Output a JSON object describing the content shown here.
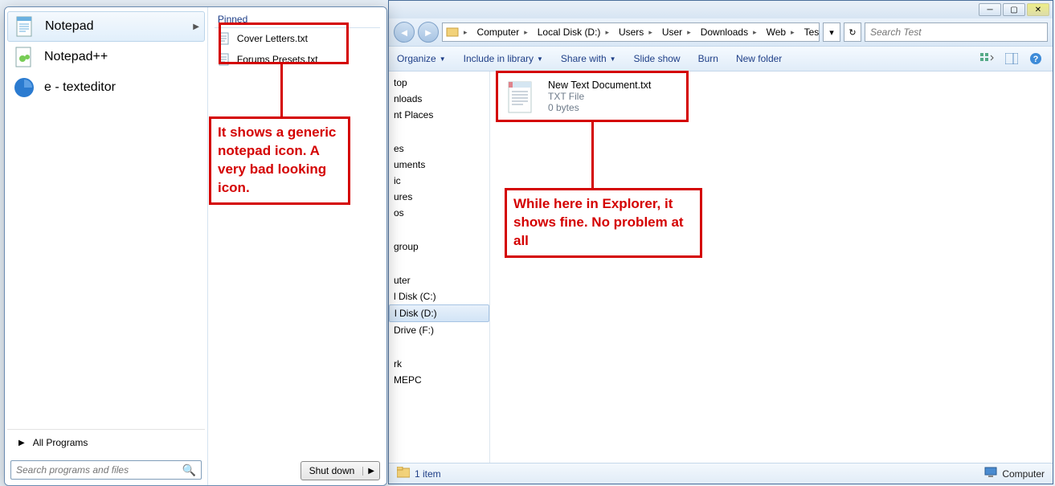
{
  "start_menu": {
    "programs": [
      {
        "name": "Notepad",
        "arrow": true,
        "highlight": true
      },
      {
        "name": "Notepad++",
        "arrow": false,
        "highlight": false
      },
      {
        "name": "e - texteditor",
        "arrow": false,
        "highlight": false
      }
    ],
    "pinned_header": "Pinned",
    "pinned_items": [
      "Cover Letters.txt",
      "Forums Presets.txt"
    ],
    "all_programs": "All Programs",
    "search_placeholder": "Search programs and files",
    "shutdown": "Shut down"
  },
  "explorer": {
    "breadcrumb": [
      "Computer",
      "Local Disk (D:)",
      "Users",
      "User",
      "Downloads",
      "Web",
      "Test"
    ],
    "search_placeholder": "Search Test",
    "toolbar": {
      "organize": "Organize",
      "include": "Include in library",
      "share": "Share with",
      "slideshow": "Slide show",
      "burn": "Burn",
      "newfolder": "New folder"
    },
    "navpane": {
      "group1": [
        "top",
        "nloads",
        "nt Places"
      ],
      "group2": [
        "es",
        "uments",
        "ic",
        "ures",
        "os"
      ],
      "group3": [
        "group"
      ],
      "group4": [
        "uter",
        "l Disk (C:)",
        "l Disk (D:)",
        "Drive (F:)"
      ],
      "group5": [
        "rk",
        "MEPC"
      ]
    },
    "file": {
      "name": "New Text Document.txt",
      "type": "TXT File",
      "size": "0 bytes"
    },
    "status": {
      "count": "1 item",
      "location": "Computer"
    }
  },
  "annotations": {
    "text1": "It shows a generic notepad icon. A very bad looking icon.",
    "text2": "While here in Explorer, it shows fine. No problem at all"
  }
}
